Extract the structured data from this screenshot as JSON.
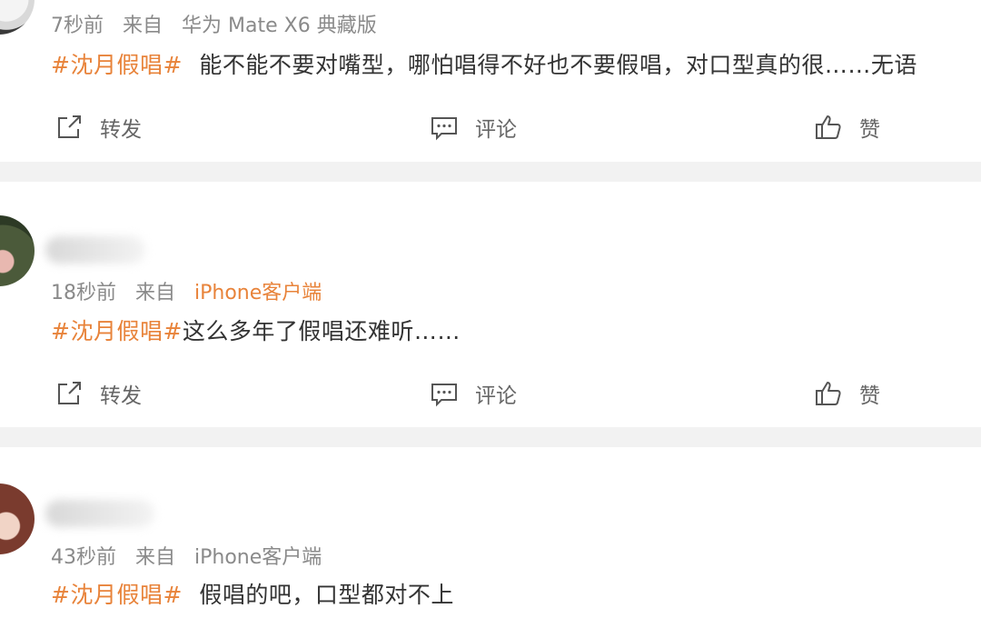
{
  "posts": [
    {
      "time": "7秒前",
      "from_label": "来自",
      "source": "华为 Mate X6 典藏版",
      "hashtag": "#沈月假唱#",
      "text": "能不能不要对嘴型，哪怕唱得不好也不要假唱，对口型真的很……无语"
    },
    {
      "time": "18秒前",
      "from_label": "来自",
      "source": "iPhone客户端",
      "hashtag": "#沈月假唱#",
      "text": "这么多年了假唱还难听……"
    },
    {
      "time": "43秒前",
      "from_label": "来自",
      "source": "iPhone客户端",
      "hashtag": "#沈月假唱#",
      "text": "假唱的吧，口型都对不上"
    }
  ],
  "actions": {
    "forward": "转发",
    "comment": "评论",
    "like": "赞"
  },
  "colors": {
    "accent": "#e8833a",
    "meta": "#8a8a8a",
    "divider": "#f2f2f2"
  }
}
